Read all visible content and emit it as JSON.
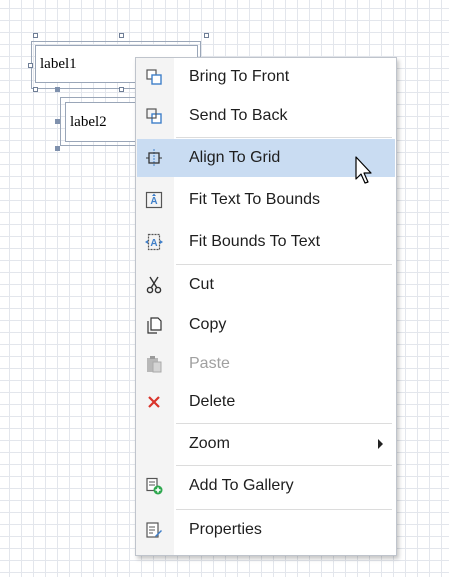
{
  "canvas": {
    "labels": [
      {
        "text": "label1"
      },
      {
        "text": "label2"
      }
    ]
  },
  "context_menu": {
    "items": [
      {
        "id": "bring-to-front",
        "label": "Bring To Front",
        "icon": "bring-to-front-icon"
      },
      {
        "id": "send-to-back",
        "label": "Send To Back",
        "icon": "send-to-back-icon"
      },
      {
        "id": "align-to-grid",
        "label": "Align To Grid",
        "icon": "align-to-grid-icon",
        "highlighted": true
      },
      {
        "id": "fit-text-to-bounds",
        "label": "Fit Text To Bounds",
        "icon": "fit-text-to-bounds-icon"
      },
      {
        "id": "fit-bounds-to-text",
        "label": "Fit Bounds To Text",
        "icon": "fit-bounds-to-text-icon"
      },
      {
        "id": "cut",
        "label": "Cut",
        "icon": "scissors-icon"
      },
      {
        "id": "copy",
        "label": "Copy",
        "icon": "copy-icon"
      },
      {
        "id": "paste",
        "label": "Paste",
        "icon": "paste-icon",
        "disabled": true
      },
      {
        "id": "delete",
        "label": "Delete",
        "icon": "delete-x-icon"
      },
      {
        "id": "zoom",
        "label": "Zoom",
        "has_submenu": true
      },
      {
        "id": "add-to-gallery",
        "label": "Add To Gallery",
        "icon": "add-to-gallery-icon"
      },
      {
        "id": "properties",
        "label": "Properties",
        "icon": "properties-icon"
      }
    ]
  },
  "colors": {
    "highlight": "#c9dcf2",
    "delete_icon": "#d9342b",
    "add_badge": "#2fa84f",
    "icon_blue": "#3f7fc9"
  }
}
